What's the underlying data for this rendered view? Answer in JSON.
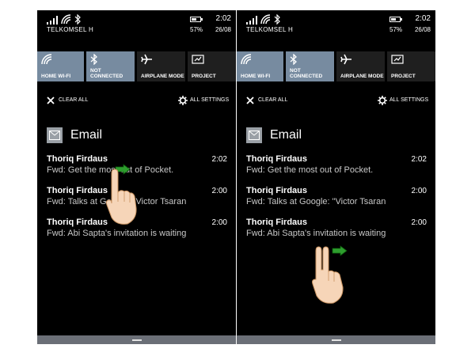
{
  "screens": [
    {
      "status": {
        "carrier": "TELKOMSEL H",
        "time": "2:02",
        "battery": "57%",
        "date": "26/08"
      },
      "quick_actions": [
        {
          "label": "HOME WI-FI",
          "icon": "wifi-icon",
          "active": true
        },
        {
          "label": "NOT CONNECTED",
          "icon": "bluetooth-icon",
          "active": true
        },
        {
          "label": "AIRPLANE MODE",
          "icon": "airplane-icon",
          "active": false
        },
        {
          "label": "PROJECT",
          "icon": "project-icon",
          "active": false
        }
      ],
      "clear_all": "CLEAR ALL",
      "all_settings": "ALL SETTINGS",
      "app": {
        "name": "Email",
        "icon": "mail-icon"
      },
      "notifications": [
        {
          "sender": "Thoriq Firdaus",
          "subject": "Fwd: Get the most out of Pocket.",
          "time": "2:02"
        },
        {
          "sender": "Thoriq Firdaus",
          "subject": "Fwd: Talks at Google: \"Victor Tsaran",
          "time": "2:00"
        },
        {
          "sender": "Thoriq Firdaus",
          "subject": "Fwd: Abi Sapta's invitation is waiting",
          "time": "2:00"
        }
      ],
      "gesture": {
        "type": "one-finger swipe right",
        "icon": "hand-one-finger-icon",
        "arrow": "arrow-right-icon"
      }
    },
    {
      "status": {
        "carrier": "TELKOMSEL H",
        "time": "2:02",
        "battery": "57%",
        "date": "26/08"
      },
      "quick_actions": [
        {
          "label": "HOME WI-FI",
          "icon": "wifi-icon",
          "active": true
        },
        {
          "label": "NOT CONNECTED",
          "icon": "bluetooth-icon",
          "active": true
        },
        {
          "label": "AIRPLANE MODE",
          "icon": "airplane-icon",
          "active": false
        },
        {
          "label": "PROJECT",
          "icon": "project-icon",
          "active": false
        }
      ],
      "clear_all": "CLEAR ALL",
      "all_settings": "ALL SETTINGS",
      "app": {
        "name": "Email",
        "icon": "mail-icon"
      },
      "notifications": [
        {
          "sender": "Thoriq Firdaus",
          "subject": "Fwd: Get the most out of Pocket.",
          "time": "2:02"
        },
        {
          "sender": "Thoriq Firdaus",
          "subject": "Fwd: Talks at Google: \"Victor Tsaran",
          "time": "2:00"
        },
        {
          "sender": "Thoriq Firdaus",
          "subject": "Fwd: Abi Sapta's invitation is waiting",
          "time": "2:00"
        }
      ],
      "gesture": {
        "type": "two-finger swipe right",
        "icon": "hand-two-fingers-icon",
        "arrow": "arrow-right-icon"
      }
    }
  ],
  "colors": {
    "background": "#000000",
    "tile_active": "#778ba0",
    "tile_inactive": "#1f1f1f",
    "nav_bar": "#6b6f77",
    "gesture_arrow": "#2e9e2e",
    "hand": "#f6d5b8"
  }
}
